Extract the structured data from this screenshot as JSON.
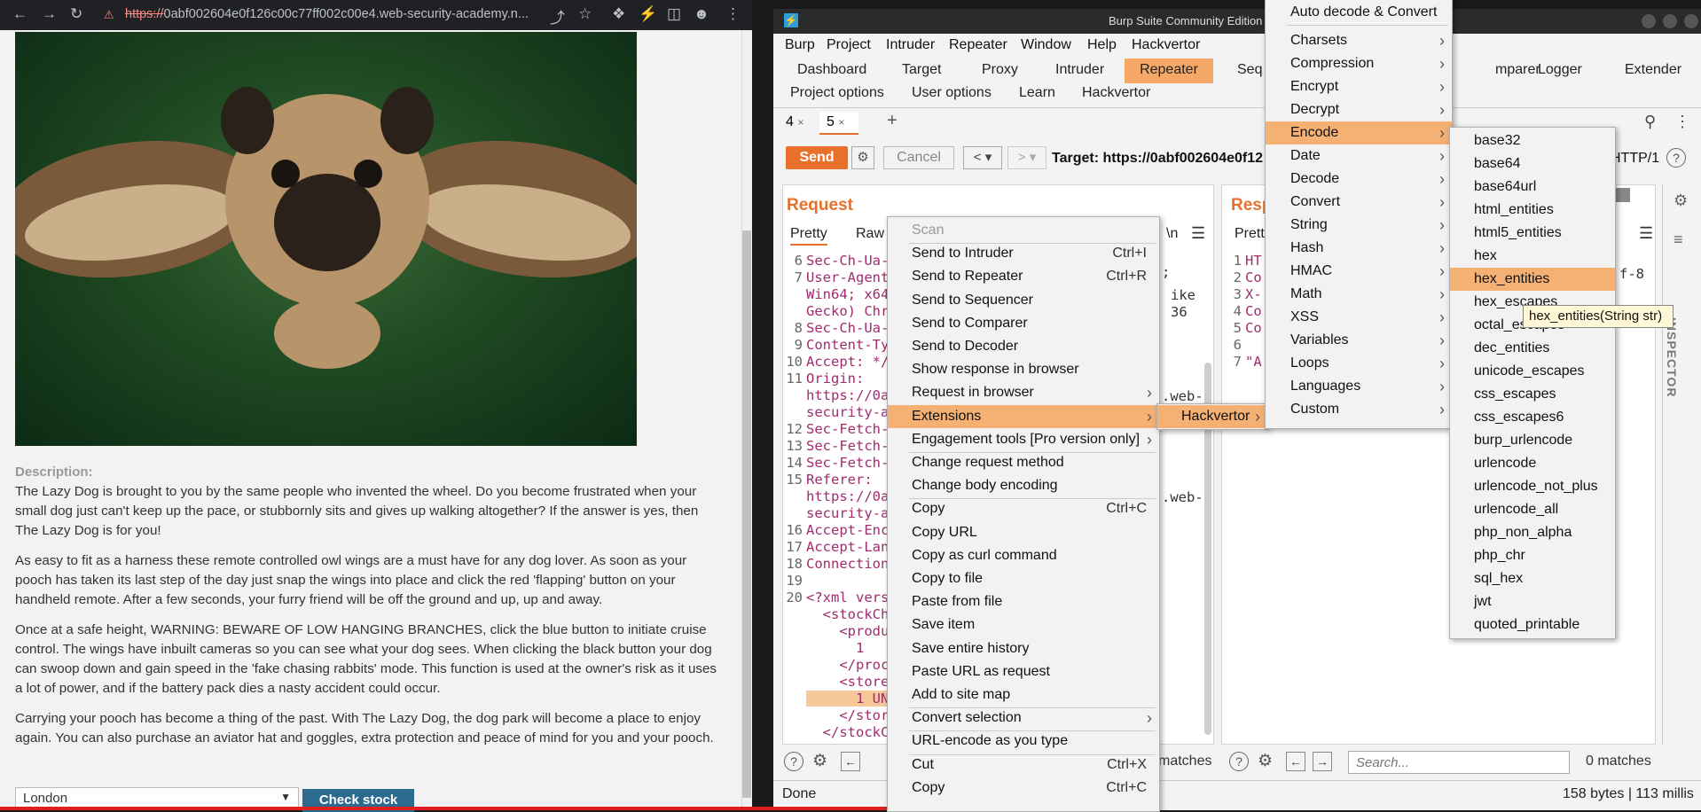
{
  "browser": {
    "url_scheme": "https://",
    "url_rest": "0abf002604e0f126c00c77ff002c00e4.web-security-academy.n...",
    "description_label": "Description:",
    "paragraphs": [
      "The Lazy Dog is brought to you by the same people who invented the wheel. Do you become frustrated when your small dog just can't keep up the pace, or stubbornly sits and gives up walking altogether? If the answer is yes, then The Lazy Dog is for you!",
      "As easy to fit as a harness these remote controlled owl wings are a must have for any dog lover. As soon as your pooch has taken its last step of the day just snap the wings into place and click the red 'flapping' button on your handheld remote. After a few seconds, your furry friend will be off the ground and up, up and away.",
      "Once at a safe height, WARNING: BEWARE OF LOW HANGING BRANCHES, click the blue button to initiate cruise control. The wings have inbuilt cameras so you can see what your dog sees. When clicking the black button your dog can swoop down and gain speed in the 'fake chasing rabbits' mode. This function is used at the owner's risk as it uses a lot of power, and if the battery pack dies a nasty accident could occur.",
      "Carrying your pooch has become a thing of the past. With The Lazy Dog, the dog park will become a place to enjoy again. You can also purchase an aviator hat and goggles, extra protection and peace of mind for you and your pooch."
    ],
    "store_value": "London",
    "check_stock_label": "Check stock"
  },
  "burp": {
    "title": "Burp Suite Community Edition v2022.7.",
    "menubar": [
      "Burp",
      "Project",
      "Intruder",
      "Repeater",
      "Window",
      "Help",
      "Hackvertor"
    ],
    "tabs_row1": [
      "Dashboard",
      "Target",
      "Proxy",
      "Intruder",
      "Repeater",
      "Seq",
      "mparer",
      "Logger",
      "Extender"
    ],
    "tabs_row2": [
      "Project options",
      "User options",
      "Learn",
      "Hackvertor"
    ],
    "sub_tabs": [
      "4",
      "5"
    ],
    "send_label": "Send",
    "cancel_label": "Cancel",
    "target_label": "Target: https://0abf002604e0f12",
    "http_version": "HTTP/1",
    "request_title": "Request",
    "response_title": "Resp",
    "request_tabs": [
      "Pretty",
      "Raw"
    ],
    "response_tabs": [
      "Prett"
    ],
    "inspector_label": "INSPECTOR",
    "request_lines": [
      {
        "n": "6",
        "t": "Sec-Ch-Ua-"
      },
      {
        "n": "7",
        "t": "User-Agent"
      },
      {
        "n": "",
        "t": "Win64; x64"
      },
      {
        "n": "",
        "t": "Gecko) Chr"
      },
      {
        "n": "8",
        "t": "Sec-Ch-Ua-"
      },
      {
        "n": "9",
        "t": "Content-Ty"
      },
      {
        "n": "10",
        "t": "Accept: */"
      },
      {
        "n": "11",
        "t": "Origin:"
      },
      {
        "n": "",
        "t": "https://0a"
      },
      {
        "n": "",
        "t": "security-a"
      },
      {
        "n": "12",
        "t": "Sec-Fetch-"
      },
      {
        "n": "13",
        "t": "Sec-Fetch-"
      },
      {
        "n": "14",
        "t": "Sec-Fetch-"
      },
      {
        "n": "15",
        "t": "Referer:"
      },
      {
        "n": "",
        "t": "https://0a"
      },
      {
        "n": "",
        "t": "security-a"
      },
      {
        "n": "16",
        "t": "Accept-Enc"
      },
      {
        "n": "17",
        "t": "Accept-Lan"
      },
      {
        "n": "18",
        "t": "Connection"
      },
      {
        "n": "19",
        "t": ""
      },
      {
        "n": "20",
        "t": "<?xml vers"
      },
      {
        "n": "",
        "t": "  <stockCh"
      },
      {
        "n": "",
        "t": "    <produ"
      },
      {
        "n": "",
        "t": "      1"
      },
      {
        "n": "",
        "t": "    </proc"
      },
      {
        "n": "",
        "t": "    <store"
      },
      {
        "n": "",
        "t": "      1 UN"
      },
      {
        "n": "",
        "t": "    </stor"
      },
      {
        "n": "",
        "t": "  </stockC"
      }
    ],
    "request_right_frags": [
      ";",
      "ike",
      "36",
      ".web-",
      ".web-"
    ],
    "response_lines": [
      {
        "n": "1",
        "t": "HT"
      },
      {
        "n": "2",
        "t": "Co"
      },
      {
        "n": "3",
        "t": "X-"
      },
      {
        "n": "4",
        "t": "Co"
      },
      {
        "n": "5",
        "t": "Co"
      },
      {
        "n": "6",
        "t": ""
      },
      {
        "n": "7",
        "t": "\"A"
      }
    ],
    "response_frag": "f-8",
    "search_placeholder": "Search...",
    "matches_label": "0 matches",
    "matches_left": "matches",
    "status_done": "Done",
    "status_size": "158 bytes | 113 millis"
  },
  "context_menu": [
    {
      "label": "Scan",
      "disabled": true
    },
    {
      "label": "Send to Intruder",
      "shortcut": "Ctrl+I"
    },
    {
      "label": "Send to Repeater",
      "shortcut": "Ctrl+R"
    },
    {
      "label": "Send to Sequencer"
    },
    {
      "label": "Send to Comparer"
    },
    {
      "label": "Send to Decoder"
    },
    {
      "label": "Show response in browser"
    },
    {
      "label": "Request in browser",
      "submenu": true
    },
    {
      "label": "Extensions",
      "submenu": true,
      "highlighted": true
    },
    {
      "label": "Engagement tools [Pro version only]",
      "submenu": true
    },
    {
      "label": "Change request method"
    },
    {
      "label": "Change body encoding"
    },
    {
      "label": "Copy",
      "shortcut": "Ctrl+C"
    },
    {
      "label": "Copy URL"
    },
    {
      "label": "Copy as curl command"
    },
    {
      "label": "Copy to file"
    },
    {
      "label": "Paste from file"
    },
    {
      "label": "Save item"
    },
    {
      "label": "Save entire history"
    },
    {
      "label": "Paste URL as request"
    },
    {
      "label": "Add to site map"
    },
    {
      "label": "Convert selection",
      "submenu": true
    },
    {
      "label": "URL-encode as you type"
    },
    {
      "label": "Cut",
      "shortcut": "Ctrl+X"
    },
    {
      "label": "Copy",
      "shortcut": "Ctrl+C"
    }
  ],
  "extensions_menu": [
    {
      "label": "Hackvertor",
      "submenu": true,
      "highlighted": true
    }
  ],
  "hackvertor_menu": [
    {
      "label": "Auto decode & Convert"
    },
    {
      "label": "Charsets",
      "submenu": true
    },
    {
      "label": "Compression",
      "submenu": true
    },
    {
      "label": "Encrypt",
      "submenu": true
    },
    {
      "label": "Decrypt",
      "submenu": true
    },
    {
      "label": "Encode",
      "submenu": true,
      "highlighted": true
    },
    {
      "label": "Date",
      "submenu": true
    },
    {
      "label": "Decode",
      "submenu": true
    },
    {
      "label": "Convert",
      "submenu": true
    },
    {
      "label": "String",
      "submenu": true
    },
    {
      "label": "Hash",
      "submenu": true
    },
    {
      "label": "HMAC",
      "submenu": true
    },
    {
      "label": "Math",
      "submenu": true
    },
    {
      "label": "XSS",
      "submenu": true
    },
    {
      "label": "Variables",
      "submenu": true
    },
    {
      "label": "Loops",
      "submenu": true
    },
    {
      "label": "Languages",
      "submenu": true
    },
    {
      "label": "Custom",
      "submenu": true
    }
  ],
  "encode_menu": [
    {
      "label": "base32"
    },
    {
      "label": "base64"
    },
    {
      "label": "base64url"
    },
    {
      "label": "html_entities"
    },
    {
      "label": "html5_entities"
    },
    {
      "label": "hex"
    },
    {
      "label": "hex_entities",
      "highlighted": true
    },
    {
      "label": "hex_escapes"
    },
    {
      "label": "octal_escapes"
    },
    {
      "label": "dec_entities"
    },
    {
      "label": "unicode_escapes"
    },
    {
      "label": "css_escapes"
    },
    {
      "label": "css_escapes6"
    },
    {
      "label": "burp_urlencode"
    },
    {
      "label": "urlencode"
    },
    {
      "label": "urlencode_not_plus"
    },
    {
      "label": "urlencode_all"
    },
    {
      "label": "php_non_alpha"
    },
    {
      "label": "php_chr"
    },
    {
      "label": "sql_hex"
    },
    {
      "label": "jwt"
    },
    {
      "label": "quoted_printable"
    }
  ],
  "tooltip": "hex_entities(String str)"
}
